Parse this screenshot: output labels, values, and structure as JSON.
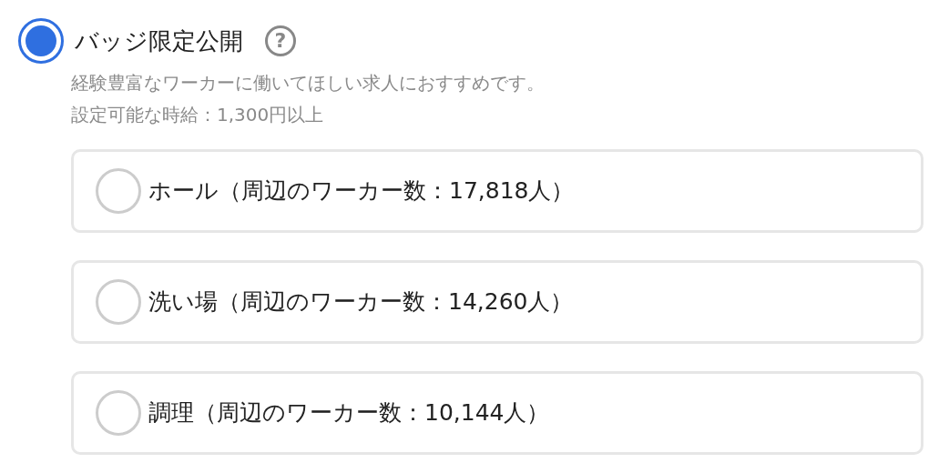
{
  "option": {
    "label": "バッジ限定公開",
    "selected": true,
    "help": "?",
    "description": [
      "経験豊富なワーカーに働いてほしい求人におすすめです。",
      "設定可能な時給：1,300円以上"
    ]
  },
  "choices": [
    {
      "label": "ホール（周辺のワーカー数：17,818人）",
      "selected": false
    },
    {
      "label": "洗い場（周辺のワーカー数：14,260人）",
      "selected": false
    },
    {
      "label": "調理（周辺のワーカー数：10,144人）",
      "selected": false
    }
  ]
}
